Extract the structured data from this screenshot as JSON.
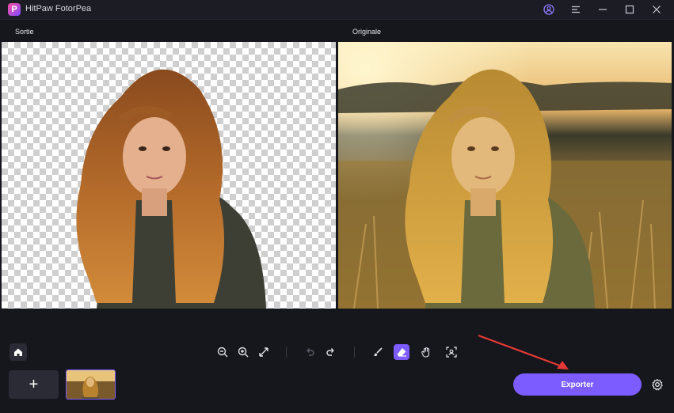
{
  "app": {
    "title": "HitPaw FotorPea",
    "logo_letter": "P"
  },
  "panels": {
    "output_label": "Sortie",
    "original_label": "Originale"
  },
  "footer": {
    "add_label": "+",
    "export_label": "Exporter"
  },
  "colors": {
    "accent": "#7c5cff",
    "background": "#16161d",
    "arrow": "#e53935"
  },
  "icons": [
    "account-icon",
    "menu-icon",
    "minimize-icon",
    "maximize-icon",
    "close-icon",
    "home-icon",
    "zoom-out-icon",
    "zoom-in-icon",
    "fit-screen-icon",
    "undo-icon",
    "redo-icon",
    "brush-icon",
    "eraser-icon",
    "hand-icon",
    "recognize-icon",
    "settings-icon"
  ]
}
